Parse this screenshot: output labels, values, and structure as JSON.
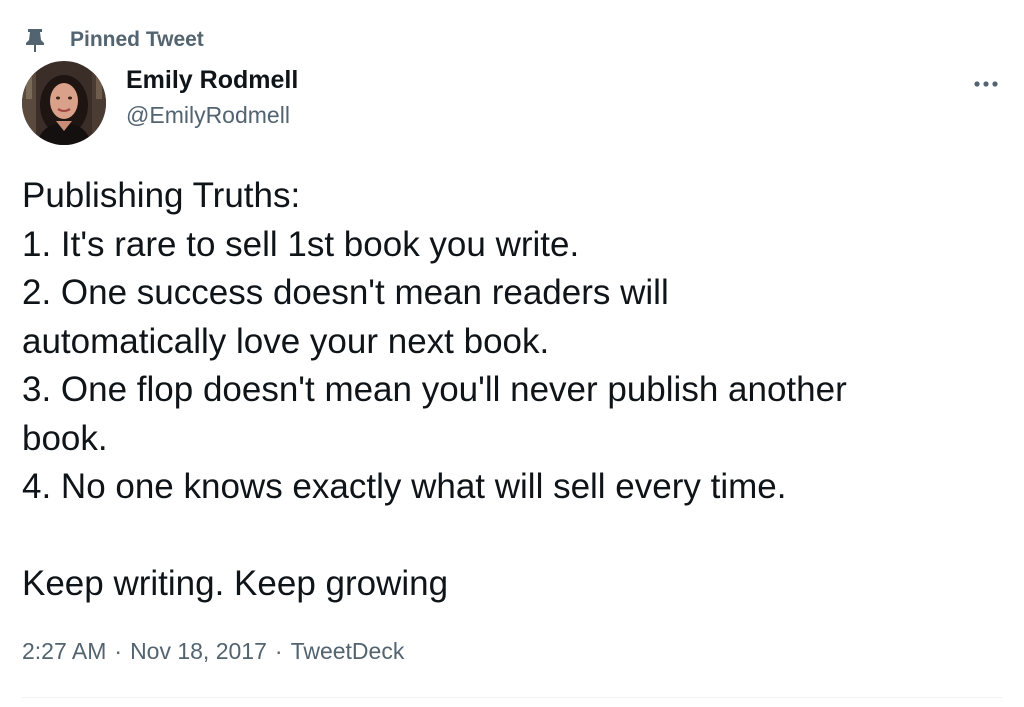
{
  "pinned": {
    "label": "Pinned Tweet",
    "icon": "pin-icon"
  },
  "author": {
    "display_name": "Emily Rodmell",
    "handle": "@EmilyRodmell"
  },
  "more_icon": "more-horizontal-icon",
  "tweet": {
    "lines": [
      "Publishing Truths:",
      "1. It's rare to sell 1st book you write.",
      "2. One success doesn't mean readers will",
      "automatically love your next book.",
      "3. One flop doesn't mean you'll never publish another",
      "book.",
      "4. No one knows exactly what will sell every time.",
      "",
      "Keep writing. Keep growing"
    ]
  },
  "meta": {
    "time": "2:27 AM",
    "separator": "·",
    "date": "Nov 18, 2017",
    "source": "TweetDeck"
  },
  "colors": {
    "text_primary": "#0f1419",
    "text_secondary": "#536471",
    "divider": "#eff3f4"
  }
}
